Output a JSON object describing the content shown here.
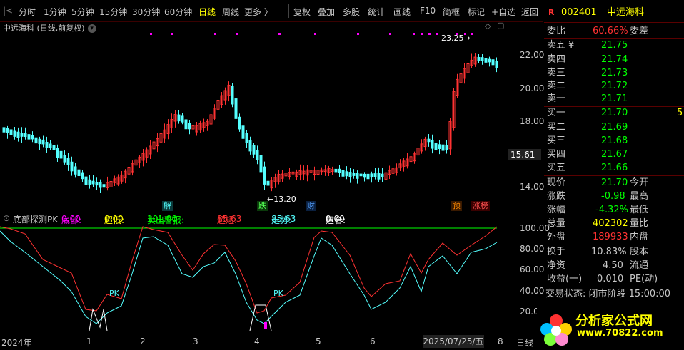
{
  "toolbar": {
    "periods": [
      "分时",
      "1分钟",
      "5分钟",
      "15分钟",
      "30分钟",
      "60分钟",
      "日线",
      "周线",
      "更多 〉"
    ],
    "active_period": "日线",
    "actions": [
      "复权",
      "叠加",
      "多股",
      "统计",
      "画线",
      "F10",
      "简框",
      "标记",
      "+自选",
      "返回"
    ]
  },
  "chart": {
    "title": "中远海科 (日线,前复权)",
    "y_ticks": [
      "22.00",
      "20.00",
      "18.00",
      "14.00"
    ],
    "current_price_tag": "15.61",
    "high_annotation": "23.25",
    "low_annotation": "13.20",
    "markers": {
      "jie": "解",
      "die": "跌",
      "cai": "财",
      "yu": "预",
      "zhangbang": "涨榜"
    },
    "colors": {
      "up": "#ff3232",
      "down": "#54ffff",
      "bg": "#000000"
    }
  },
  "indicator": {
    "name": "底部探测PK",
    "items": [
      {
        "label": "底部:",
        "value": "0.00",
        "color": "#ff00ff"
      },
      {
        "label": "超低:",
        "value": "0.00",
        "color": "#ffff00"
      },
      {
        "label": "卖出警报:",
        "value": "101.00",
        "color": "#00ff00"
      },
      {
        "label": "超短:",
        "value": "85.63",
        "color": "#ff3232"
      },
      {
        "label": "走势:",
        "value": "85.63",
        "color": "#54ffff"
      },
      {
        "label": "建合:",
        "value": "0.00",
        "color": "#ffffff"
      }
    ],
    "y_ticks": [
      "100.00",
      "80.00",
      "60.00",
      "40.00",
      "20.00"
    ],
    "pk_labels": [
      "PK",
      "PK"
    ]
  },
  "time_axis": {
    "labels": [
      "2024年",
      "1",
      "2",
      "3",
      "4",
      "5",
      "6",
      "8"
    ],
    "cursor_date": "2025/07/25/五",
    "period_label": "日线"
  },
  "quote": {
    "code": "002401",
    "name": "中远海科",
    "weibi_label": "委比",
    "weibi_value": "60.66%",
    "weicha_label": "委差",
    "asks": [
      {
        "label": "卖五",
        "price": "21.75"
      },
      {
        "label": "卖四",
        "price": "21.74"
      },
      {
        "label": "卖三",
        "price": "21.73"
      },
      {
        "label": "卖二",
        "price": "21.72"
      },
      {
        "label": "卖一",
        "price": "21.71"
      }
    ],
    "bids": [
      {
        "label": "买一",
        "price": "21.70"
      },
      {
        "label": "买二",
        "price": "21.69"
      },
      {
        "label": "买三",
        "price": "21.68"
      },
      {
        "label": "买四",
        "price": "21.67"
      },
      {
        "label": "买五",
        "price": "21.66"
      }
    ],
    "currency_mark": "¥",
    "bid_side_mark": "5",
    "stats": [
      {
        "label": "现价",
        "value": "21.70",
        "right": "今开",
        "color": "#00ff00"
      },
      {
        "label": "涨跌",
        "value": "-0.98",
        "right": "最高",
        "color": "#00ff00"
      },
      {
        "label": "涨幅",
        "value": "-4.32%",
        "right": "最低",
        "color": "#00ff00"
      },
      {
        "label": "总量",
        "value": "402302",
        "right": "量比",
        "color": "#ffff00"
      },
      {
        "label": "外盘",
        "value": "189933",
        "right": "内盘",
        "color": "#ff3232"
      }
    ],
    "stats2": [
      {
        "label": "换手",
        "value": "10.83%",
        "right": "股本"
      },
      {
        "label": "净资",
        "value": "4.50",
        "right": "流通"
      },
      {
        "label": "收益(一)",
        "value": "0.010",
        "right": "PE(动)"
      }
    ],
    "trade_status": "交易状态: 闭市阶段 15:00:00"
  },
  "watermark": {
    "title": "分析家公式网",
    "url": "www.70822.com"
  }
}
